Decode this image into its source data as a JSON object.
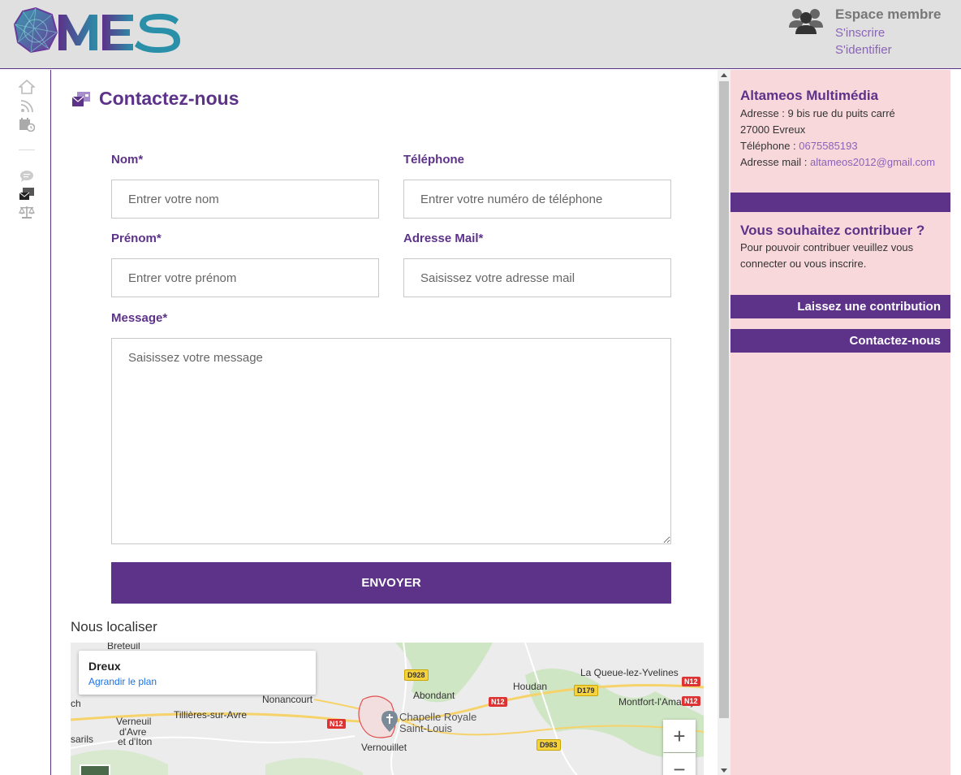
{
  "header": {
    "logo_text": "MES",
    "member_title": "Espace membre",
    "signup_label": "S'inscrire",
    "login_label": "S'identifier"
  },
  "leftbar": {
    "icons": [
      "home-icon",
      "rss-icon",
      "calendar-clock-icon",
      "chat-icon",
      "contact-mail-icon",
      "balance-scale-icon"
    ]
  },
  "main": {
    "title": "Contactez-nous",
    "form": {
      "nom_label": "Nom*",
      "nom_placeholder": "Entrer votre nom",
      "telephone_label": "Téléphone",
      "telephone_placeholder": "Entrer votre numéro de téléphone",
      "prenom_label": "Prénom*",
      "prenom_placeholder": "Entrer votre prénom",
      "email_label": "Adresse Mail*",
      "email_placeholder": "Saisissez votre adresse mail",
      "message_label": "Message*",
      "message_placeholder": "Saisissez votre message",
      "submit_label": "ENVOYER"
    },
    "locate_title": "Nous localiser",
    "map": {
      "card_title": "Dreux",
      "card_link": "Agrandir le plan",
      "places": [
        "Breteuil",
        "Nonancourt",
        "Tillières-sur-Avre",
        "Verneuil",
        "d'Avre",
        "et d'Iton",
        "sarils",
        "Abondant",
        "Houdan",
        "La Queue-lez-Yvelines",
        "Montfort-l'Amaury",
        "Vernouillet",
        "ch"
      ],
      "poi_line1": "Chapelle Royale",
      "poi_line2": "Saint-Louis",
      "roads": [
        "D928",
        "N12",
        "D179",
        "N12",
        "N12",
        "N12",
        "D983"
      ],
      "zoom_in": "+",
      "zoom_out": "−"
    }
  },
  "sidebar": {
    "company": "Altameos Multimédia",
    "address_line": "Adresse : 9 bis rue du puits carré",
    "city_line": "27000 Evreux",
    "phone_label": "Téléphone : ",
    "phone_value": "0675585193",
    "email_label": "Adresse mail : ",
    "email_value": "altameos2012@gmail.com",
    "contribute_title": "Vous souhaitez contribuer ?",
    "contribute_line1": "Pour pouvoir contribuer veuillez vous",
    "contribute_line2": "connecter ou vous inscrire.",
    "contribution_button": "Laissez une contribution",
    "contact_button": "Contactez-nous"
  },
  "colors": {
    "brand_purple": "#5d3289",
    "accent_light_purple": "#8a63b8",
    "sidebar_pink": "#f9d8dc",
    "header_gray": "#e0e0e0"
  }
}
